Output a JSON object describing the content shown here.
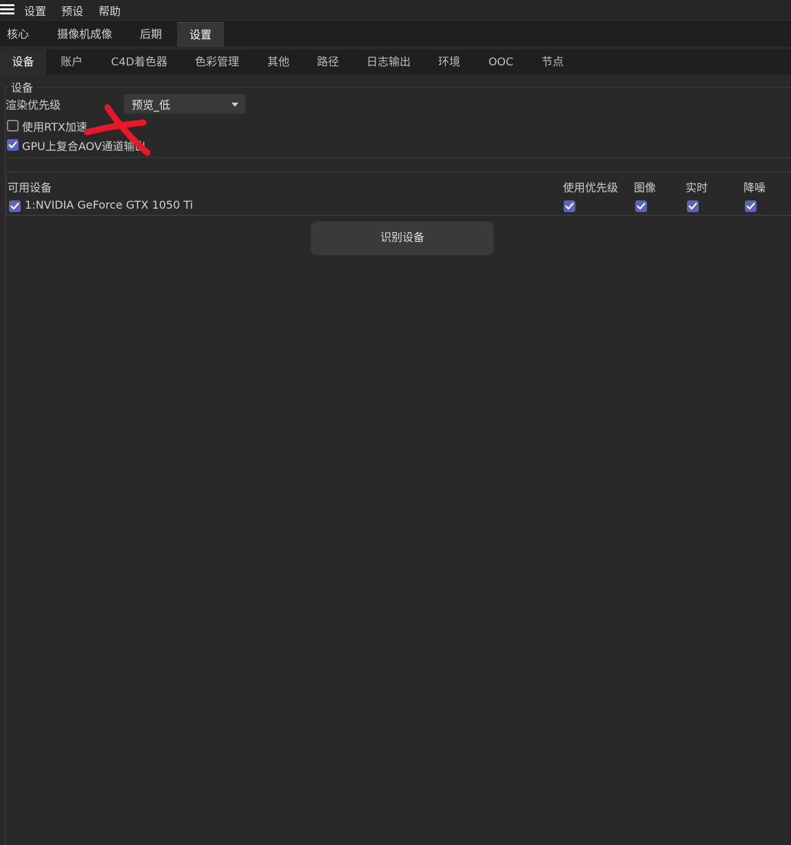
{
  "menubar": {
    "items": [
      "设置",
      "预设",
      "帮助"
    ]
  },
  "top_tabs": [
    "核心",
    "摄像机成像",
    "后期",
    "设置"
  ],
  "top_tabs_active": "设置",
  "sub_tabs": [
    "设备",
    "账户",
    "C4D着色器",
    "色彩管理",
    "其他",
    "路径",
    "日志输出",
    "环境",
    "OOC",
    "节点"
  ],
  "sub_tabs_active": "设备",
  "device_group": {
    "title": "设备",
    "render_priority_label": "渲染优先级",
    "render_priority_value": "预览_低",
    "use_rtx_label": "使用RTX加速",
    "use_rtx_checked": false,
    "gpu_aov_label": "GPU上复合AOV通道输出",
    "gpu_aov_checked": true
  },
  "devices_table": {
    "headers": {
      "available": "可用设备",
      "priority": "使用优先级",
      "image": "图像",
      "realtime": "实时",
      "denoise": "降噪"
    },
    "rows": [
      {
        "enabled": true,
        "name": "1:NVIDIA GeForce GTX 1050 Ti",
        "priority": true,
        "image": true,
        "realtime": true,
        "denoise": true
      }
    ]
  },
  "identify_button": "识别设备",
  "colors": {
    "background": "#292929",
    "checkbox_on": "#5b64b8",
    "annotation_red": "#e8182a"
  }
}
